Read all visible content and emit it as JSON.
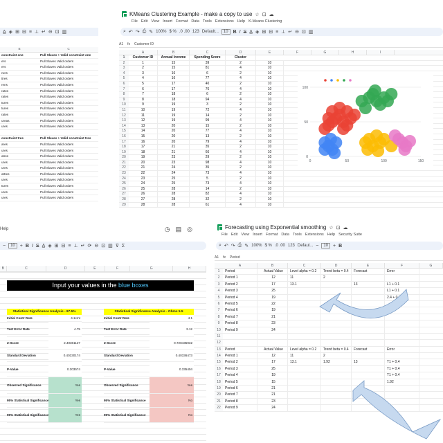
{
  "top_left": {
    "header_left": "constraint one",
    "header_right": "Pull Slaves + Valid constraint one",
    "rows_a": [
      [
        "ers",
        "Pull Slaves Valid orders"
      ],
      [
        "ers",
        "Pull Slaves Valid orders"
      ],
      [
        "ners",
        "Pull Slaves Valid orders"
      ],
      [
        "tires",
        "Pull Slaves Valid orders"
      ],
      [
        "rens",
        "Pull Slaves Valid orders"
      ],
      [
        "rates",
        "Pull Slaves Valid orders"
      ],
      [
        "rates",
        "Pull Slaves Valid orders"
      ],
      [
        "tures",
        "Pull Slaves Valid orders"
      ],
      [
        "tures",
        "Pull Slaves Valid orders"
      ],
      [
        "rates",
        "Pull Slaves Valid orders"
      ],
      [
        "ureas",
        "Pull Slaves Valid orders"
      ],
      [
        "ures",
        "Pull Slaves Valid orders"
      ]
    ],
    "header2_left": "constraint tres",
    "header2_right": "Pull Slaves + Valid constraint tres",
    "rows_b": [
      [
        "ares",
        "Pull Slaves Valid orders"
      ],
      [
        "ures",
        "Pull Slaves Valid orders"
      ],
      [
        "atres",
        "Pull Slaves Valid orders"
      ],
      [
        "ures",
        "Pull Slaves Valid orders"
      ],
      [
        "ures",
        "Pull Slaves Valid orders"
      ],
      [
        "attres",
        "Pull Slaves Valid orders"
      ],
      [
        "ures",
        "Pull Slaves Valid orders"
      ],
      [
        "tures",
        "Pull Slaves Valid orders"
      ],
      [
        "ures",
        "Pull Slaves Valid orders"
      ],
      [
        "ures",
        "Pull Slaves Valid orders"
      ],
      [
        "ures",
        "Pull Slaves Valid orders"
      ],
      [
        "ures",
        "Pull Slaves Valid orders"
      ]
    ],
    "col_labels": [
      "B",
      "C"
    ]
  },
  "kmeans": {
    "title": "KMeans Clustering Example - make a copy to use",
    "menu": [
      "File",
      "Edit",
      "View",
      "Insert",
      "Format",
      "Data",
      "Tools",
      "Extensions",
      "Help",
      "K-Means Clustering"
    ],
    "zoom": "100%",
    "font": "Default...",
    "font_size": "10",
    "cell_ref": "A1",
    "formula": "Customer ID",
    "col_letters": [
      "A",
      "B",
      "C",
      "D",
      "E",
      "F",
      "G",
      "H",
      "I"
    ],
    "headers": [
      "Customer ID",
      "Annual Income",
      "Spending Score",
      "Cluster"
    ],
    "rows": [
      [
        1,
        15,
        39,
        2,
        10
      ],
      [
        2,
        15,
        81,
        4,
        10
      ],
      [
        3,
        16,
        6,
        2,
        10
      ],
      [
        4,
        16,
        77,
        4,
        10
      ],
      [
        5,
        17,
        40,
        2,
        10
      ],
      [
        6,
        17,
        76,
        4,
        10
      ],
      [
        7,
        18,
        6,
        2,
        10
      ],
      [
        8,
        18,
        94,
        4,
        10
      ],
      [
        9,
        19,
        3,
        2,
        10
      ],
      [
        10,
        19,
        72,
        4,
        10
      ],
      [
        11,
        19,
        14,
        2,
        10
      ],
      [
        12,
        19,
        99,
        4,
        10
      ],
      [
        13,
        20,
        15,
        2,
        10
      ],
      [
        14,
        20,
        77,
        4,
        10
      ],
      [
        15,
        20,
        13,
        2,
        10
      ],
      [
        16,
        20,
        79,
        4,
        10
      ],
      [
        17,
        21,
        35,
        2,
        10
      ],
      [
        18,
        21,
        66,
        4,
        10
      ],
      [
        19,
        23,
        29,
        2,
        10
      ],
      [
        20,
        23,
        98,
        4,
        10
      ],
      [
        21,
        24,
        35,
        2,
        10
      ],
      [
        22,
        24,
        73,
        4,
        10
      ],
      [
        23,
        25,
        5,
        2,
        10
      ],
      [
        24,
        25,
        73,
        4,
        10
      ],
      [
        25,
        28,
        14,
        2,
        10
      ],
      [
        26,
        28,
        82,
        4,
        10
      ],
      [
        27,
        28,
        32,
        2,
        10
      ],
      [
        28,
        28,
        61,
        4,
        10
      ]
    ]
  },
  "chart_data": {
    "type": "scatter",
    "title": "",
    "xlabel": "",
    "ylabel": "",
    "xlim": [
      0,
      150
    ],
    "ylim": [
      0,
      100
    ],
    "x_ticks": [
      "0",
      "50",
      "100",
      "150"
    ],
    "y_ticks": [
      "0",
      "50",
      "100"
    ],
    "legend_position": "top",
    "series": [
      {
        "color": "#ea4335",
        "points": [
          [
            20,
            40
          ],
          [
            25,
            45
          ],
          [
            30,
            50
          ],
          [
            35,
            55
          ],
          [
            40,
            60
          ],
          [
            45,
            50
          ],
          [
            50,
            45
          ],
          [
            55,
            55
          ],
          [
            60,
            60
          ],
          [
            30,
            65
          ],
          [
            40,
            70
          ],
          [
            50,
            65
          ],
          [
            25,
            55
          ],
          [
            45,
            40
          ]
        ]
      },
      {
        "color": "#4285f4",
        "points": [
          [
            20,
            20
          ],
          [
            25,
            15
          ],
          [
            30,
            10
          ],
          [
            35,
            20
          ],
          [
            20,
            10
          ],
          [
            28,
            25
          ],
          [
            33,
            5
          ]
        ]
      },
      {
        "color": "#fbbc04",
        "points": [
          [
            75,
            20
          ],
          [
            80,
            25
          ],
          [
            85,
            15
          ],
          [
            90,
            30
          ],
          [
            95,
            20
          ],
          [
            100,
            25
          ],
          [
            110,
            15
          ],
          [
            78,
            10
          ],
          [
            92,
            8
          ]
        ]
      },
      {
        "color": "#34a853",
        "points": [
          [
            70,
            80
          ],
          [
            80,
            85
          ],
          [
            85,
            90
          ],
          [
            90,
            80
          ],
          [
            95,
            75
          ],
          [
            100,
            85
          ],
          [
            110,
            90
          ],
          [
            75,
            70
          ],
          [
            88,
            95
          ],
          [
            105,
            80
          ]
        ]
      },
      {
        "color": "#e879c7",
        "points": [
          [
            120,
            25
          ],
          [
            125,
            20
          ],
          [
            130,
            15
          ],
          [
            115,
            30
          ],
          [
            135,
            22
          ],
          [
            128,
            10
          ]
        ]
      }
    ]
  },
  "stat": {
    "menu_label": "Help",
    "font_size": "10",
    "instruction": "Input your values in the blue boxes",
    "instruction_highlight": "blue boxes",
    "col_letters": [
      "B",
      "C",
      "D",
      "E",
      "F",
      "G",
      "H"
    ],
    "left": {
      "title": "Statistical Significance Analysis - 97.5%",
      "rows": [
        [
          "Initial Contr Rate",
          "4.1cmt"
        ],
        [
          "Test Error Rate",
          "4.75"
        ],
        [
          "Z-Score",
          "2.40361127"
        ],
        [
          "Standard Deviation",
          "0.40330174"
        ],
        [
          "P-Value",
          "0.303574"
        ],
        [
          "Observed Significance",
          "Yes"
        ],
        [
          "95% Statistical Significance",
          "Yes"
        ],
        [
          "99% Statistical Significance",
          "Yes"
        ]
      ]
    },
    "right": {
      "title": "Statistical Significance Analysis - Ohms 5.5",
      "rows": [
        [
          "Initial Contr Rate",
          "4.1"
        ],
        [
          "Test Error Rate",
          "3.12"
        ],
        [
          "Z-Score",
          "0.720435932"
        ],
        [
          "Standard Deviation",
          "0.40336473"
        ],
        [
          "P-Value",
          "0.335404"
        ],
        [
          "Observed Significance",
          "Yes"
        ],
        [
          "95% Statistical Significance",
          "No"
        ],
        [
          "99% Statistical Significance",
          "No"
        ]
      ]
    }
  },
  "forecast": {
    "title": "Forecasting using Exponential smoothing",
    "menu": [
      "File",
      "Edit",
      "View",
      "Insert",
      "Format",
      "Data",
      "Tools",
      "Extensions",
      "Help",
      "Security Suite"
    ],
    "zoom": "100%",
    "cell_ref": "A1",
    "formula": "Period",
    "col_letters": [
      "A",
      "B",
      "C",
      "D",
      "E",
      "F",
      "G"
    ],
    "headers": [
      "Period",
      "Actual Value",
      "Level alpha = 0.2",
      "Trend beta = 0.4",
      "Forecast",
      "Error"
    ],
    "table1": [
      [
        "Period 1",
        "12",
        "11",
        "2",
        "",
        ""
      ],
      [
        "Period 2",
        "17",
        "13.1",
        "",
        "13",
        "L1 + 0.1"
      ],
      [
        "Period 3",
        "25",
        "",
        "",
        "",
        "L1 + 0.1"
      ],
      [
        "Period 4",
        "19",
        "",
        "",
        "",
        "2.4 + 0.2"
      ],
      [
        "Period 5",
        "22",
        "",
        "",
        "",
        ""
      ],
      [
        "Period 6",
        "19",
        "",
        "",
        "",
        ""
      ],
      [
        "Period 7",
        "21",
        "",
        "",
        "",
        ""
      ],
      [
        "Period 8",
        "23",
        "",
        "",
        "",
        ""
      ],
      [
        "Period 9",
        "24",
        "",
        "",
        "",
        ""
      ]
    ],
    "table2": [
      [
        "Period 1",
        "12",
        "11",
        "2",
        "",
        ""
      ],
      [
        "Period 2",
        "17",
        "13.1",
        "1.92",
        "13",
        "T1 + 0.4"
      ],
      [
        "Period 3",
        "25",
        "",
        "",
        "",
        "T1 + 0.4"
      ],
      [
        "Period 4",
        "19",
        "",
        "",
        "",
        "T1 + 0.4"
      ],
      [
        "Period 5",
        "15",
        "",
        "",
        "",
        "1.92"
      ],
      [
        "Period 6",
        "21",
        "",
        "",
        "",
        ""
      ],
      [
        "Period 7",
        "21",
        "",
        "",
        "",
        ""
      ],
      [
        "Period 8",
        "23",
        "",
        "",
        "",
        ""
      ],
      [
        "Period 9",
        "24",
        "",
        "",
        "",
        ""
      ]
    ]
  }
}
